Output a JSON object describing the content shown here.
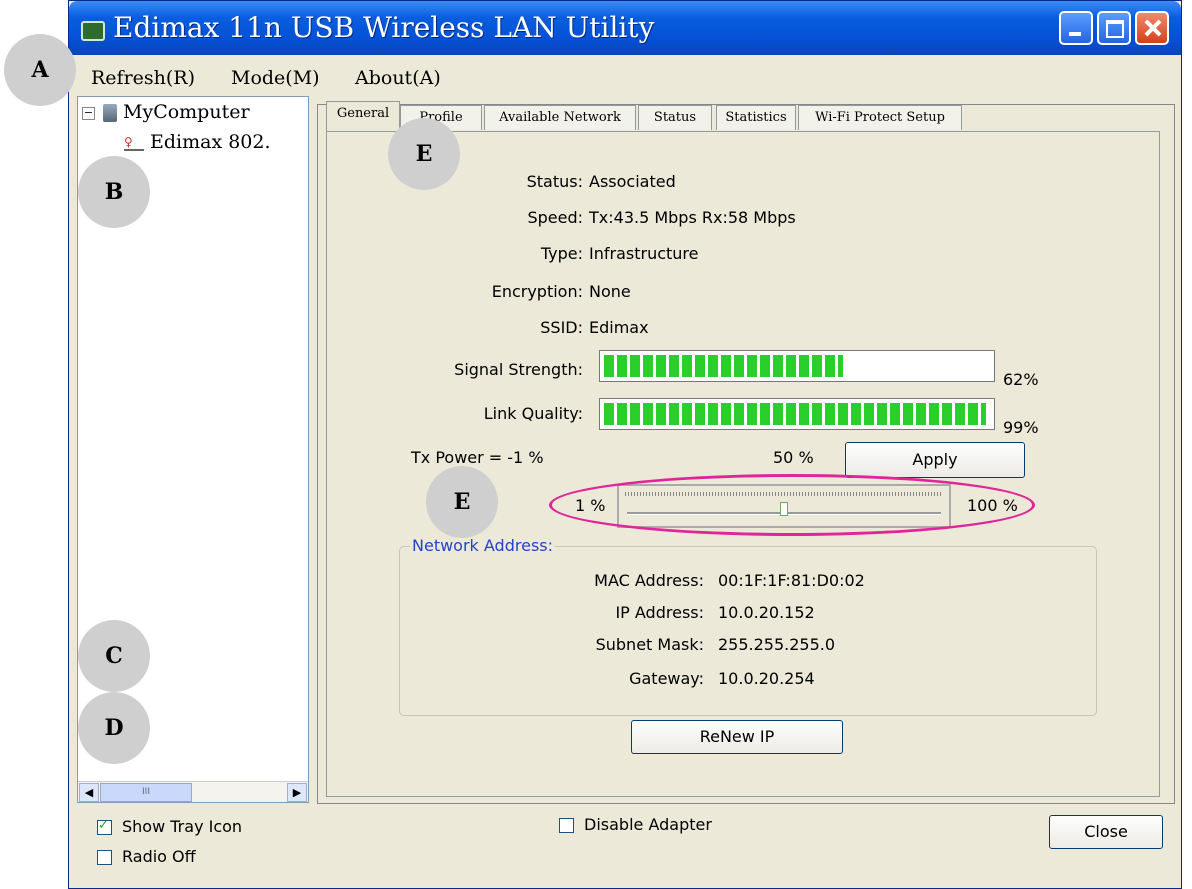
{
  "window": {
    "title": "Edimax 11n USB Wireless LAN Utility"
  },
  "menu": {
    "items": [
      "Refresh(R)",
      "Mode(M)",
      "About(A)"
    ]
  },
  "tree": {
    "root": "MyComputer",
    "child": "Edimax 802."
  },
  "tabs": [
    "General",
    "Profile",
    "Available Network",
    "Status",
    "Statistics",
    "Wi-Fi Protect Setup"
  ],
  "general": {
    "status_label": "Status:",
    "status_value": "Associated",
    "speed_label": "Speed:",
    "speed_value": "Tx:43.5 Mbps Rx:58 Mbps",
    "type_label": "Type:",
    "type_value": "Infrastructure",
    "encryption_label": "Encryption:",
    "encryption_value": "None",
    "ssid_label": "SSID:",
    "ssid_value": "Edimax",
    "signal_label": "Signal Strength:",
    "signal_percent": "62%",
    "signal_fraction": 0.62,
    "link_label": "Link Quality:",
    "link_percent": "99%",
    "link_fraction": 0.99,
    "txpower_label": "Tx Power =  -1 %",
    "txpower_mid": "50 %",
    "apply_label": "Apply",
    "slider_min": "1 %",
    "slider_max": "100 %",
    "slider_fraction": 0.5
  },
  "network": {
    "title": "Network Address:",
    "mac_label": "MAC Address:",
    "mac_value": "00:1F:1F:81:D0:02",
    "ip_label": "IP Address:",
    "ip_value": "10.0.20.152",
    "subnet_label": "Subnet Mask:",
    "subnet_value": "255.255.255.0",
    "gateway_label": "Gateway:",
    "gateway_value": "10.0.20.254",
    "renew_label": "ReNew IP"
  },
  "bottom": {
    "show_tray": "Show Tray Icon",
    "show_tray_checked": true,
    "radio_off": "Radio Off",
    "radio_off_checked": false,
    "disable_adapter": "Disable Adapter",
    "disable_adapter_checked": false,
    "close_label": "Close"
  },
  "callouts": [
    "A",
    "B",
    "C",
    "D",
    "E",
    "E"
  ],
  "colors": {
    "title_bar": "#0551d6",
    "bar_green": "#2bcf2b",
    "highlight_oval": "#e0249a",
    "group_title": "#2244cc"
  }
}
